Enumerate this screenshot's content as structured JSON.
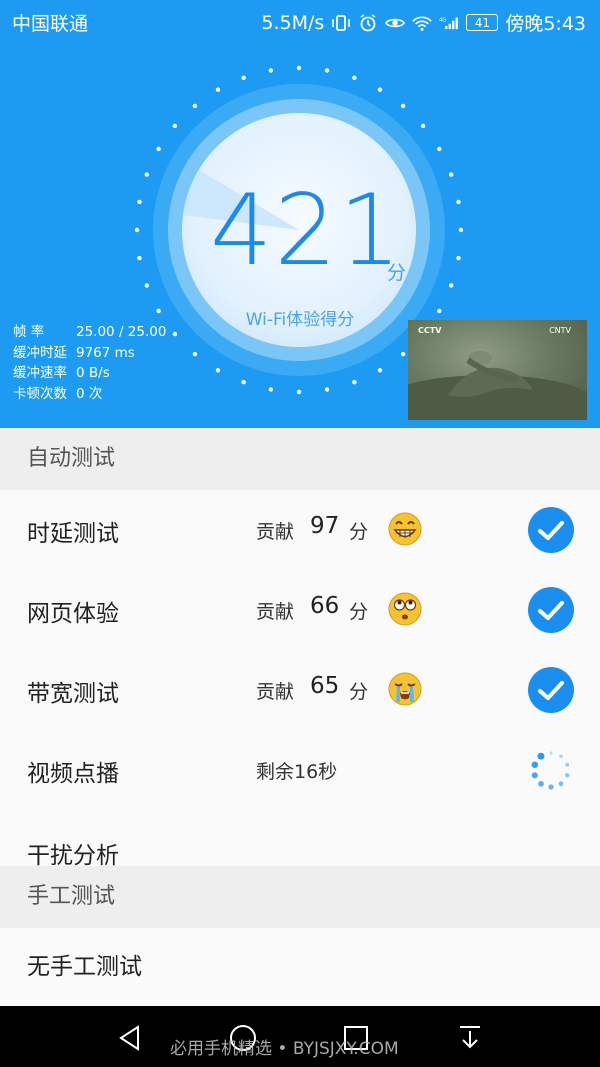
{
  "status_bar": {
    "carrier": "中国联通",
    "speed": "5.5M/s",
    "network": "4G",
    "battery": "41",
    "time": "傍晚5:43"
  },
  "score": {
    "value": "421",
    "unit": "分",
    "caption": "Wi-Fi体验得分"
  },
  "stats": [
    {
      "label": "帧  率",
      "value": "25.00 / 25.00"
    },
    {
      "label": "缓冲时延",
      "value": "9767 ms"
    },
    {
      "label": "缓冲速率",
      "value": "0 B/s"
    },
    {
      "label": "卡顿次数",
      "value": "0 次"
    }
  ],
  "video": {
    "logo_left": "CCTV",
    "logo_right": "CNTV"
  },
  "auto_test": {
    "header": "自动测试",
    "items": [
      {
        "name": "时延测试",
        "contrib_label": "贡献",
        "points": "97",
        "unit": "分",
        "emoji": "grin-emoji",
        "status": "done"
      },
      {
        "name": "网页体验",
        "contrib_label": "贡献",
        "points": "66",
        "unit": "分",
        "emoji": "eyeroll-emoji",
        "status": "done"
      },
      {
        "name": "带宽测试",
        "contrib_label": "贡献",
        "points": "65",
        "unit": "分",
        "emoji": "crying-emoji",
        "status": "done"
      },
      {
        "name": "视频点播",
        "remaining": "剩余16秒",
        "status": "running"
      },
      {
        "name": "干扰分析"
      }
    ]
  },
  "manual_test": {
    "header": "手工测试",
    "empty": "无手工测试"
  },
  "nav": {
    "watermark": "必用手机精选 • BYJSJXY.COM"
  },
  "colors": {
    "hero_bg": "#1d9bf2",
    "accent": "#1a8ff0",
    "emoji_yellow": "#f5c232"
  }
}
